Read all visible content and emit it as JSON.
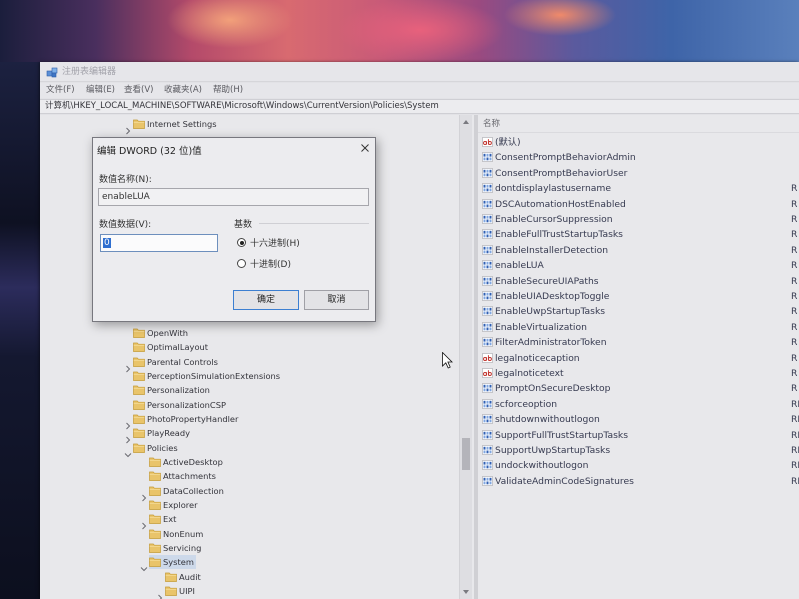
{
  "window": {
    "title": "注册表编辑器"
  },
  "menu": [
    "文件(F)",
    "编辑(E)",
    "查看(V)",
    "收藏夹(A)",
    "帮助(H)"
  ],
  "address_bar": "计算机\\HKEY_LOCAL_MACHINE\\SOFTWARE\\Microsoft\\Windows\\CurrentVersion\\Policies\\System",
  "tree": {
    "items_above": [
      {
        "label": "Internet Settings",
        "level": 0,
        "expander": "collapsed"
      }
    ],
    "items": [
      {
        "label": "OpenWith",
        "level": 0,
        "expander": "none"
      },
      {
        "label": "OptimalLayout",
        "level": 0,
        "expander": "none"
      },
      {
        "label": "Parental Controls",
        "level": 0,
        "expander": "collapsed"
      },
      {
        "label": "PerceptionSimulationExtensions",
        "level": 0,
        "expander": "none"
      },
      {
        "label": "Personalization",
        "level": 0,
        "expander": "none"
      },
      {
        "label": "PersonalizationCSP",
        "level": 0,
        "expander": "none"
      },
      {
        "label": "PhotoPropertyHandler",
        "level": 0,
        "expander": "collapsed"
      },
      {
        "label": "PlayReady",
        "level": 0,
        "expander": "collapsed"
      },
      {
        "label": "Policies",
        "level": 0,
        "expander": "expanded"
      },
      {
        "label": "ActiveDesktop",
        "level": 1,
        "expander": "none"
      },
      {
        "label": "Attachments",
        "level": 1,
        "expander": "none"
      },
      {
        "label": "DataCollection",
        "level": 1,
        "expander": "collapsed"
      },
      {
        "label": "Explorer",
        "level": 1,
        "expander": "none"
      },
      {
        "label": "Ext",
        "level": 1,
        "expander": "collapsed"
      },
      {
        "label": "NonEnum",
        "level": 1,
        "expander": "none"
      },
      {
        "label": "Servicing",
        "level": 1,
        "expander": "none"
      },
      {
        "label": "System",
        "level": 1,
        "expander": "expanded",
        "selected": true
      },
      {
        "label": "Audit",
        "level": 2,
        "expander": "none"
      },
      {
        "label": "UIPI",
        "level": 2,
        "expander": "collapsed"
      }
    ]
  },
  "values": {
    "header_name": "名称",
    "rows": [
      {
        "name": "(默认)",
        "icon": "string-value-icon",
        "type_fragment": ""
      },
      {
        "name": "ConsentPromptBehaviorAdmin",
        "icon": "dword-value-icon",
        "type_fragment": ""
      },
      {
        "name": "ConsentPromptBehaviorUser",
        "icon": "dword-value-icon",
        "type_fragment": ""
      },
      {
        "name": "dontdisplaylastusername",
        "icon": "dword-value-icon",
        "type_fragment": "R"
      },
      {
        "name": "DSCAutomationHostEnabled",
        "icon": "dword-value-icon",
        "type_fragment": "R"
      },
      {
        "name": "EnableCursorSuppression",
        "icon": "dword-value-icon",
        "type_fragment": "R"
      },
      {
        "name": "EnableFullTrustStartupTasks",
        "icon": "dword-value-icon",
        "type_fragment": "R"
      },
      {
        "name": "EnableInstallerDetection",
        "icon": "dword-value-icon",
        "type_fragment": "R"
      },
      {
        "name": "enableLUA",
        "icon": "dword-value-icon",
        "type_fragment": "R"
      },
      {
        "name": "EnableSecureUIAPaths",
        "icon": "dword-value-icon",
        "type_fragment": "R"
      },
      {
        "name": "EnableUIADesktopToggle",
        "icon": "dword-value-icon",
        "type_fragment": "R"
      },
      {
        "name": "EnableUwpStartupTasks",
        "icon": "dword-value-icon",
        "type_fragment": "R"
      },
      {
        "name": "EnableVirtualization",
        "icon": "dword-value-icon",
        "type_fragment": "R"
      },
      {
        "name": "FilterAdministratorToken",
        "icon": "dword-value-icon",
        "type_fragment": "R"
      },
      {
        "name": "legalnoticecaption",
        "icon": "string-value-icon",
        "type_fragment": "R"
      },
      {
        "name": "legalnoticetext",
        "icon": "string-value-icon",
        "type_fragment": "R"
      },
      {
        "name": "PromptOnSecureDesktop",
        "icon": "dword-value-icon",
        "type_fragment": "R"
      },
      {
        "name": "scforceoption",
        "icon": "dword-value-icon",
        "type_fragment": "RE"
      },
      {
        "name": "shutdownwithoutlogon",
        "icon": "dword-value-icon",
        "type_fragment": "RE"
      },
      {
        "name": "SupportFullTrustStartupTasks",
        "icon": "dword-value-icon",
        "type_fragment": "RE"
      },
      {
        "name": "SupportUwpStartupTasks",
        "icon": "dword-value-icon",
        "type_fragment": "RE"
      },
      {
        "name": "undockwithoutlogon",
        "icon": "dword-value-icon",
        "type_fragment": "RE"
      },
      {
        "name": "ValidateAdminCodeSignatures",
        "icon": "dword-value-icon",
        "type_fragment": "RE"
      }
    ]
  },
  "dialog": {
    "title": "编辑 DWORD (32 位)值",
    "name_label": "数值名称(N):",
    "name_value": "enableLUA",
    "data_label": "数值数据(V):",
    "data_value": "0",
    "base_label": "基数",
    "radio_hex": "十六进制(H)",
    "radio_dec": "十进制(D)",
    "base_selected": "hex",
    "ok": "确定",
    "cancel": "取消"
  },
  "colors": {
    "selection": "#cdd9ea",
    "focus_border": "#3c7fd1",
    "folder": "#e9c46a",
    "string_icon": "#c0302a",
    "dword_icon": "#2f5fb3"
  }
}
